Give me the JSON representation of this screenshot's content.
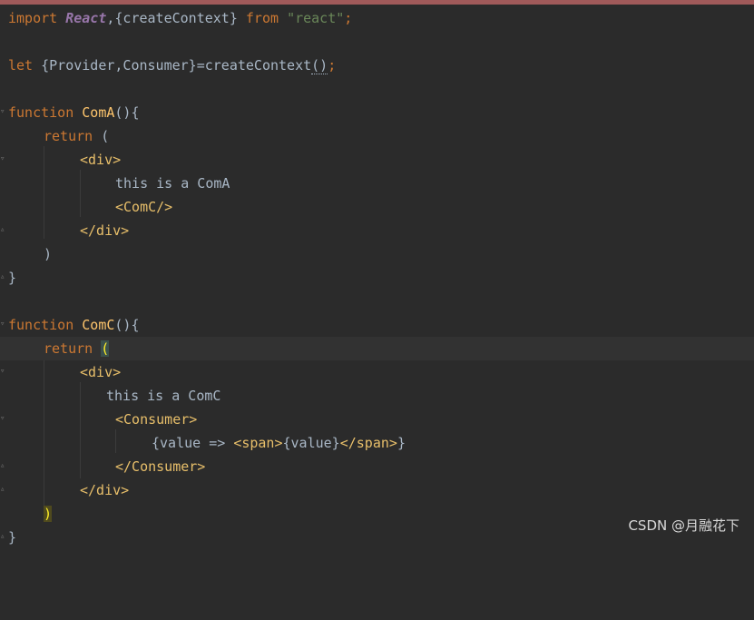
{
  "lines": {
    "l1": {
      "kw": "import ",
      "cls": "React",
      "rest1": ",{createContext} ",
      "kw2": "from ",
      "str": "\"react\"",
      "end": ";"
    },
    "l3": {
      "kw": "let ",
      "rest": "{Provider,Consumer}=createContext",
      "paren": "()",
      "end": ";"
    },
    "l5": {
      "kw": "function ",
      "fn": "ComA",
      "rest": "(){"
    },
    "l6": {
      "kw": "return ",
      "rest": "("
    },
    "l7": {
      "tag": "<div>"
    },
    "l8": {
      "text": "this is a ComA"
    },
    "l9": {
      "tag": "<ComC/>"
    },
    "l10": {
      "tag": "</div>"
    },
    "l11": {
      "rest": ")"
    },
    "l12": {
      "rest": "}"
    },
    "l14": {
      "kw": "function ",
      "fn": "ComC",
      "rest": "(){"
    },
    "l15": {
      "kw": "return ",
      "paren": "("
    },
    "l16": {
      "tag": "<div>"
    },
    "l17": {
      "text": "this is a ComC"
    },
    "l18": {
      "tag": "<Consumer>"
    },
    "l19": {
      "p1": "{value => ",
      "tag1": "<span>",
      "p2": "{value}",
      "tag2": "</span>",
      "p3": "}"
    },
    "l20": {
      "tag": "</Consumer>"
    },
    "l21": {
      "tag": "</div>"
    },
    "l22": {
      "paren": ")"
    },
    "l23": {
      "rest": "}"
    }
  },
  "watermark": "CSDN @月融花下",
  "colors": {
    "background": "#2b2b2b",
    "keyword": "#cc7832",
    "string": "#6a8759",
    "function": "#ffc66d",
    "tag": "#e8bf6a",
    "text": "#a9b7c6"
  }
}
